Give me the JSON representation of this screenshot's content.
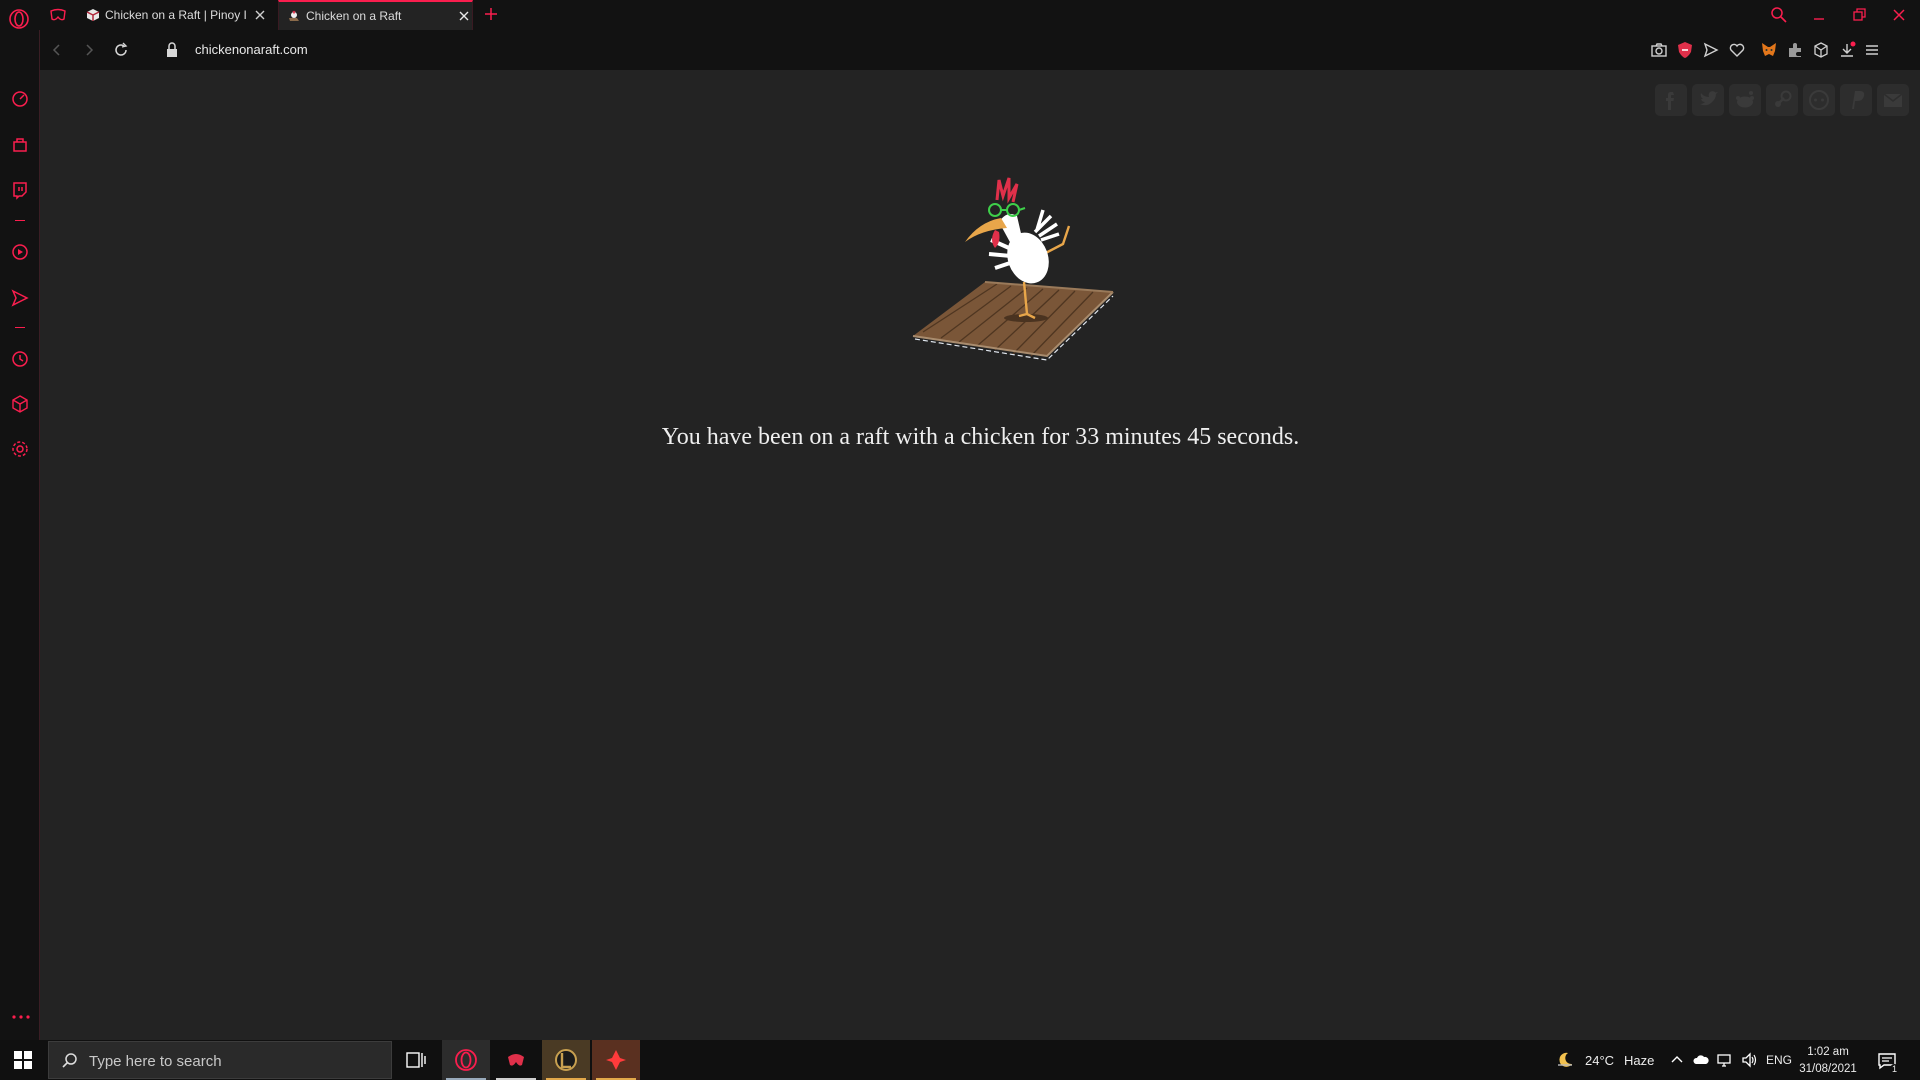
{
  "tabs": [
    {
      "title": "Chicken on a Raft | Pinoy In",
      "active": false
    },
    {
      "title": "Chicken on a Raft",
      "active": true
    }
  ],
  "address": {
    "url": "chickenonaraft.com"
  },
  "page": {
    "message": "You have been on a raft with a chicken for 33 minutes 45 seconds.",
    "share_icons": [
      "facebook-icon",
      "twitter-icon",
      "reddit-alien-icon",
      "steam-icon",
      "reddit-icon",
      "paypal-icon",
      "email-icon"
    ]
  },
  "taskbar": {
    "search_placeholder": "Type here to search",
    "weather_temp": "24°C",
    "weather_desc": "Haze",
    "language": "ENG",
    "time": "1:02 am",
    "date": "31/08/2021",
    "notification_count": "1"
  },
  "colors": {
    "accent": "#fa1e4e",
    "background": "#232323",
    "chrome": "#121212"
  }
}
